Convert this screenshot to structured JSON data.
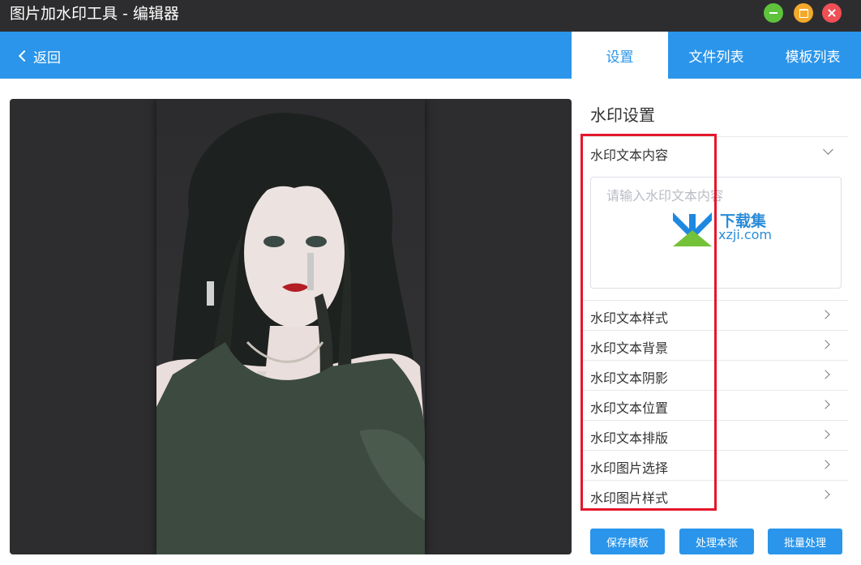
{
  "window": {
    "title": "图片加水印工具 - 编辑器",
    "controls": [
      "minimize-icon",
      "maximize-icon",
      "close-icon"
    ],
    "colors": {
      "minimize": "#5ec33b",
      "maximize": "#f4a92a",
      "close": "#ef4f55"
    }
  },
  "header": {
    "back_label": "返回",
    "accent": "#2a95ea"
  },
  "tabs": [
    {
      "label": "设置",
      "active": true
    },
    {
      "label": "文件列表",
      "active": false
    },
    {
      "label": "模板列表",
      "active": false
    }
  ],
  "panel": {
    "title": "水印设置",
    "content_section": {
      "label": "水印文本内容",
      "placeholder": "请输入水印文本内容",
      "value": ""
    },
    "sections": [
      {
        "label": "水印文本样式"
      },
      {
        "label": "水印文本背景"
      },
      {
        "label": "水印文本阴影"
      },
      {
        "label": "水印文本位置"
      },
      {
        "label": "水印文本排版"
      },
      {
        "label": "水印图片选择"
      },
      {
        "label": "水印图片样式"
      }
    ]
  },
  "actions": {
    "save_template": "保存模板",
    "process_current": "处理本张",
    "batch_process": "批量处理"
  },
  "overlay": {
    "logo_text": "下载集",
    "logo_domain": "xzji.com",
    "highlight_color": "#e5162b"
  }
}
